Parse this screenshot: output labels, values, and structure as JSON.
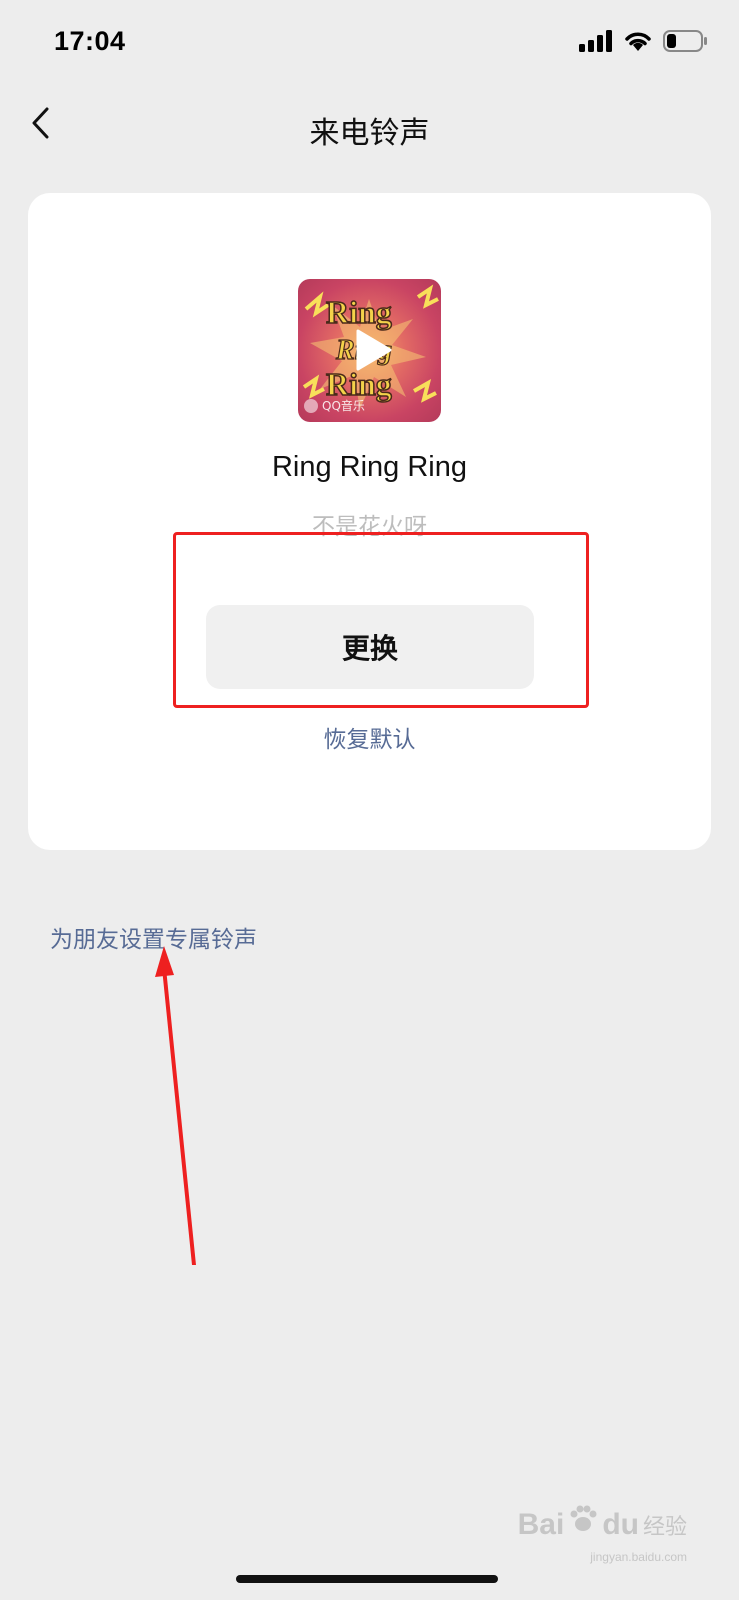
{
  "status_bar": {
    "time": "17:04",
    "icons": [
      "signal-icon",
      "wifi-icon",
      "battery-icon"
    ],
    "battery_level": 0.25
  },
  "nav": {
    "title": "来电铃声",
    "back_icon": "chevron-left-icon"
  },
  "ringtone": {
    "album_art": {
      "lettering": "Ring Ring Ring",
      "badge": "QQ音乐"
    },
    "title": "Ring Ring Ring",
    "artist": "不是花火呀"
  },
  "actions": {
    "change_label": "更换",
    "restore_label": "恢复默认"
  },
  "friend_link": "为朋友设置专属铃声",
  "watermark": {
    "brand": "Bai",
    "brand_suffix": "du",
    "cn": "经验",
    "url": "jingyan.baidu.com"
  },
  "colors": {
    "background": "#ededed",
    "card": "#ffffff",
    "link": "#576b95",
    "annotation": "#ee2020",
    "button": "#f0f0f0"
  }
}
